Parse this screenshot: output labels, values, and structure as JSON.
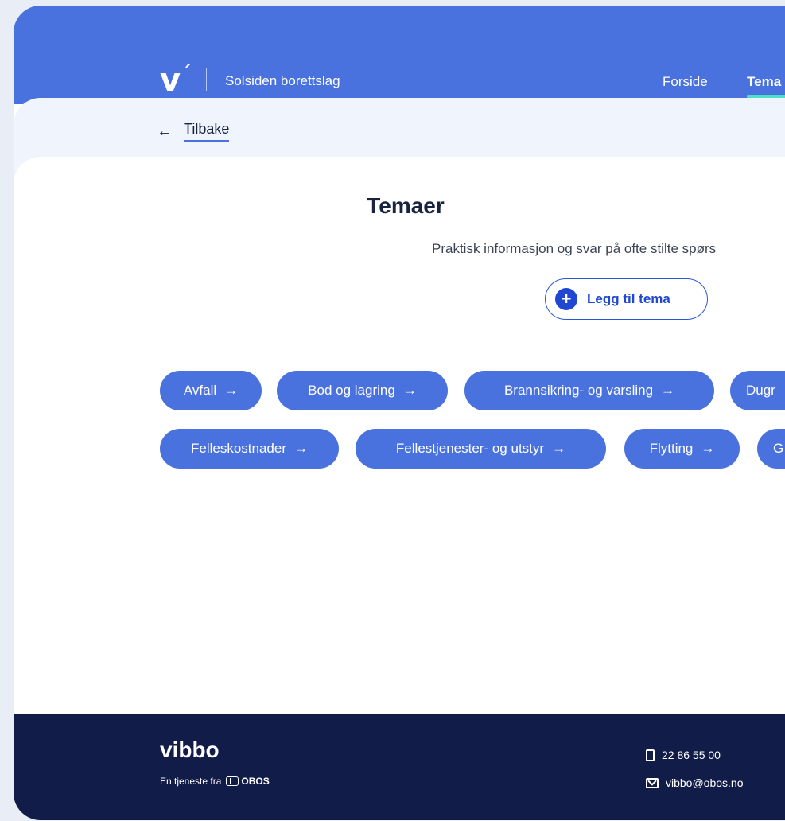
{
  "header": {
    "logo": "v",
    "logo_tick": "´",
    "org_name": "Solsiden borettslag",
    "nav": [
      {
        "label": "Forside"
      },
      {
        "label": "Tema"
      }
    ]
  },
  "back": {
    "arrow": "←",
    "label": "Tilbake"
  },
  "main": {
    "title": "Temaer",
    "subtitle": "Praktisk informasjon og svar på ofte stilte spørs",
    "add_button": {
      "icon": "+",
      "label": "Legg til tema"
    }
  },
  "topics": [
    {
      "label": "Avfall"
    },
    {
      "label": "Bod og lagring"
    },
    {
      "label": "Brannsikring- og varsling"
    },
    {
      "label": "Dugr"
    },
    {
      "label": "Felleskostnader"
    },
    {
      "label": "Fellestjenester- og utstyr"
    },
    {
      "label": "Flytting"
    },
    {
      "label": "G"
    }
  ],
  "chip_arrow": "→",
  "footer": {
    "brand": "vibbo",
    "tagline": "En tjeneste fra",
    "obos": "OBOS",
    "phone": "22 86 55 00",
    "email": "vibbo@obos.no"
  },
  "colors": {
    "accent": "#4a72de",
    "footer_bg": "#111d48",
    "nav_underline": "#4ee0c6"
  }
}
